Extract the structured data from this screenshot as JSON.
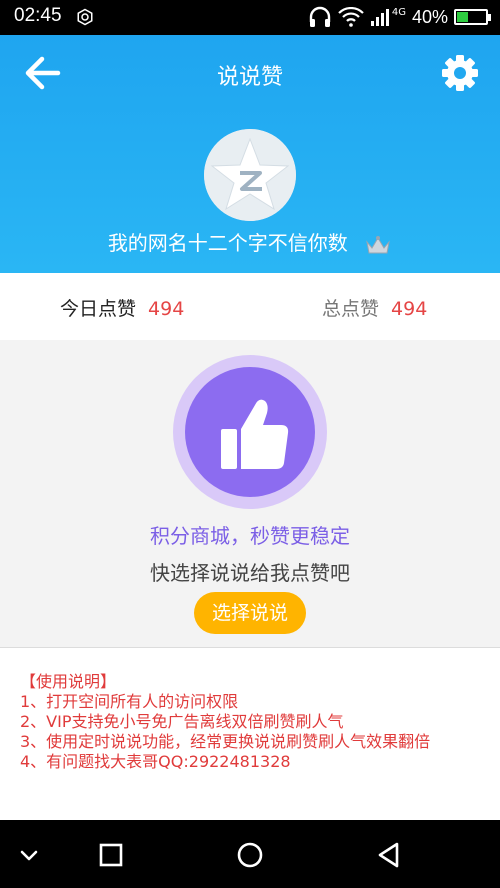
{
  "status_bar": {
    "time": "02:45",
    "network": "4G",
    "battery_percent": "40%",
    "battery_level": 0.4
  },
  "header": {
    "title": "说说赞",
    "username": "我的网名十二个字不信你数"
  },
  "stats": {
    "today_label": "今日点赞",
    "today_value": "494",
    "total_label": "总点赞",
    "total_value": "494"
  },
  "main": {
    "promo_text": "积分商城，秒赞更稳定",
    "prompt_text": "快选择说说给我点赞吧",
    "choose_button": "选择说说"
  },
  "instructions": {
    "title": "【使用说明】",
    "lines": [
      "1、打开空间所有人的访问权限",
      "2、VIP支持免小号免广告离线双倍刷赞刷人气",
      "3、使用定时说说功能，经常更换说说刷赞刷人气效果翻倍",
      "4、有问题找大表哥QQ:2922481328"
    ]
  },
  "colors": {
    "header_blue": "#1fa5f0",
    "accent_red": "#e54545",
    "purple": "#8c6cf0",
    "button_orange": "#ffb400"
  },
  "icons": {
    "back": "arrow-left-icon",
    "settings": "gear-icon",
    "like": "thumbs-up-icon",
    "avatar": "qzone-star-icon",
    "vip": "vip-crown-icon"
  }
}
